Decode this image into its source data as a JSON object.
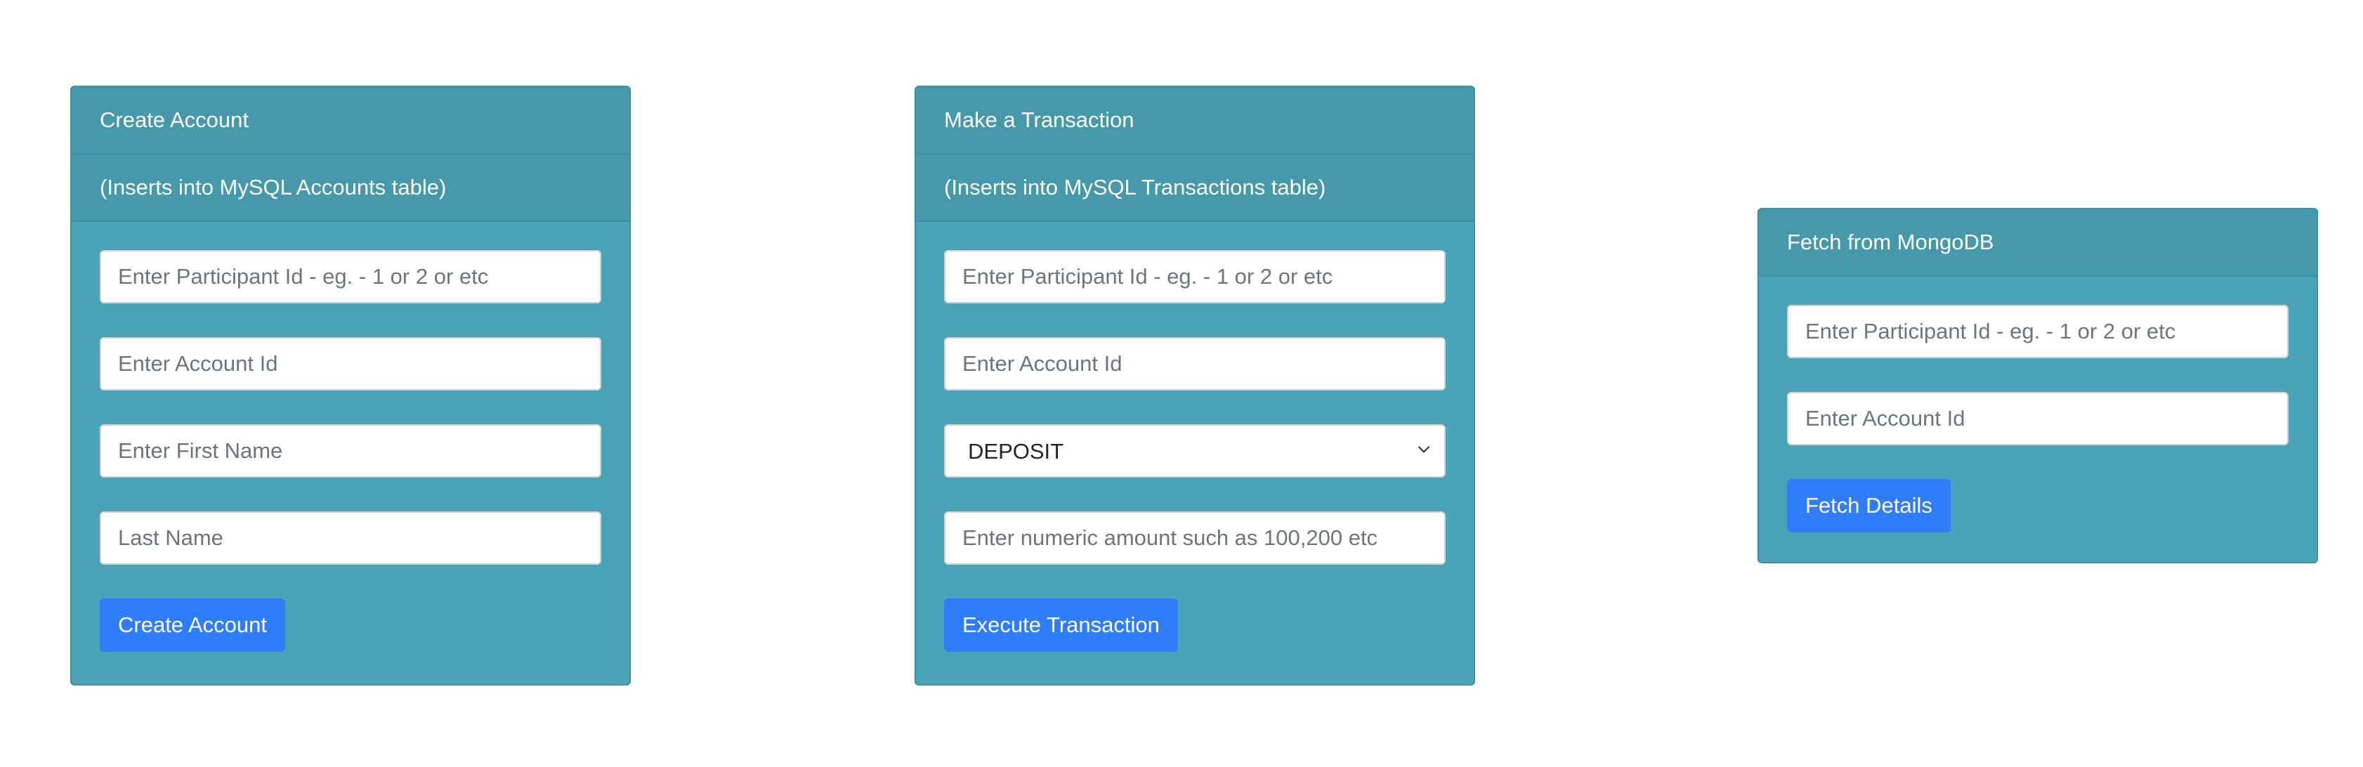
{
  "create_account": {
    "title": "Create Account",
    "subtitle": "(Inserts into MySQL Accounts table)",
    "participant_placeholder": "Enter Participant Id - eg. - 1 or 2 or etc",
    "account_placeholder": "Enter Account Id",
    "first_name_placeholder": "Enter First Name",
    "last_name_placeholder": "Last Name",
    "button_label": "Create Account"
  },
  "transaction": {
    "title": "Make a Transaction",
    "subtitle": "(Inserts into MySQL Transactions table)",
    "participant_placeholder": "Enter Participant Id - eg. - 1 or 2 or etc",
    "account_placeholder": "Enter Account Id",
    "type_selected": "DEPOSIT",
    "amount_placeholder": "Enter numeric amount such as 100,200 etc",
    "button_label": "Execute Transaction"
  },
  "fetch": {
    "title": "Fetch from MongoDB",
    "participant_placeholder": "Enter Participant Id - eg. - 1 or 2 or etc",
    "account_placeholder": "Enter Account Id",
    "button_label": "Fetch Details"
  },
  "colors": {
    "card_bg": "#4aa3b6",
    "header_bg": "#4698ab",
    "button_bg": "#2f7dfa"
  },
  "icons": {
    "select_chevron": "chevron-down-icon"
  }
}
